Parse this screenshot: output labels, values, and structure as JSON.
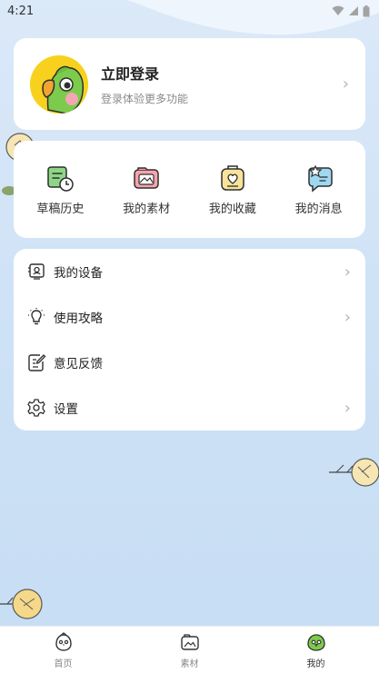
{
  "status_bar": {
    "time": "4:21"
  },
  "profile": {
    "title": "立即登录",
    "subtitle": "登录体验更多功能"
  },
  "quick_actions": [
    {
      "label": "草稿历史",
      "icon": "draft-history-icon"
    },
    {
      "label": "我的素材",
      "icon": "material-icon"
    },
    {
      "label": "我的收藏",
      "icon": "favorites-icon"
    },
    {
      "label": "我的消息",
      "icon": "messages-icon"
    }
  ],
  "menu": [
    {
      "label": "我的设备",
      "icon": "device-icon",
      "chevron": true
    },
    {
      "label": "使用攻略",
      "icon": "lightbulb-icon",
      "chevron": true
    },
    {
      "label": "意见反馈",
      "icon": "feedback-icon",
      "chevron": false
    },
    {
      "label": "设置",
      "icon": "gear-icon",
      "chevron": true
    }
  ],
  "tabbar": [
    {
      "label": "首页",
      "icon": "home-bird-icon"
    },
    {
      "label": "素材",
      "icon": "material-folder-icon"
    },
    {
      "label": "我的",
      "icon": "mine-bird-icon",
      "active": true
    }
  ]
}
